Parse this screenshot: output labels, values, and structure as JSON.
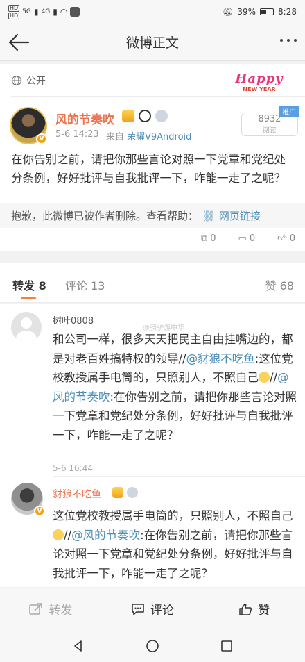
{
  "status_bar": {
    "carrier_tag_1": "HD",
    "carrier_tag_2": "HD",
    "net_1": "5G",
    "net_2": "4G",
    "battery": "39%",
    "time": "8:28"
  },
  "header": {
    "title": "微博正文"
  },
  "post": {
    "visibility": "公开",
    "banner_main": "Happy",
    "banner_sub": "NEW YEAR",
    "author": "风的节奏吹",
    "date": "5-6 14:23",
    "from_label": "来自",
    "source": "荣耀V9Android",
    "promo_tag": "推广",
    "read_count": "8932",
    "read_label": "阅读",
    "text": "在你告别之前，请把你那些言论对照一下党章和党纪处分条例，好好批评与自我批评一下，咋能一走了之呢？",
    "deleted_notice": "抱歉，此微博已被作者删除。查看帮助：",
    "help_link": "网页链接",
    "mini_repost": "0",
    "mini_comment": "0",
    "mini_like": "0"
  },
  "tabs": {
    "repost": "转发 8",
    "comment": "评论 13",
    "like": "赞 68"
  },
  "reposts": [
    {
      "user": "树叶0808",
      "text_a": "和公司一样，很多天天把民主自由挂嘴边的，都是对老百姓搞特权的领导//",
      "mention_1": "@豺狼不吃鱼",
      "text_b": ":这位党校教授属手电筒的，只照别人，不照自己",
      "text_c": "//",
      "mention_2": "@风的节奏吹",
      "text_d": ":在你告别之前，请把你那些言论对照一下党章和党纪处分条例，好好批评与自我批评一下，咋能一走了之呢？",
      "time": "5-6 16:44",
      "watermark": "@骑驴游中华"
    },
    {
      "user": "豺狼不吃鱼",
      "text_a": "这位党校教授属手电筒的，只照别人，不照自己",
      "text_b": "//",
      "mention_1": "@风的节奏吹",
      "text_c": ":在你告别之前，请把你那些言论对照一下党章和党纪处分条例，好好批评与自我批评一下，咋能一走了之呢？"
    }
  ],
  "action_bar": {
    "repost": "转发",
    "comment": "评论",
    "like": "赞"
  },
  "colors": {
    "accent_orange": "#eb7350",
    "link_blue": "#4d8fb9",
    "tab_underline": "#fa7d3c"
  }
}
